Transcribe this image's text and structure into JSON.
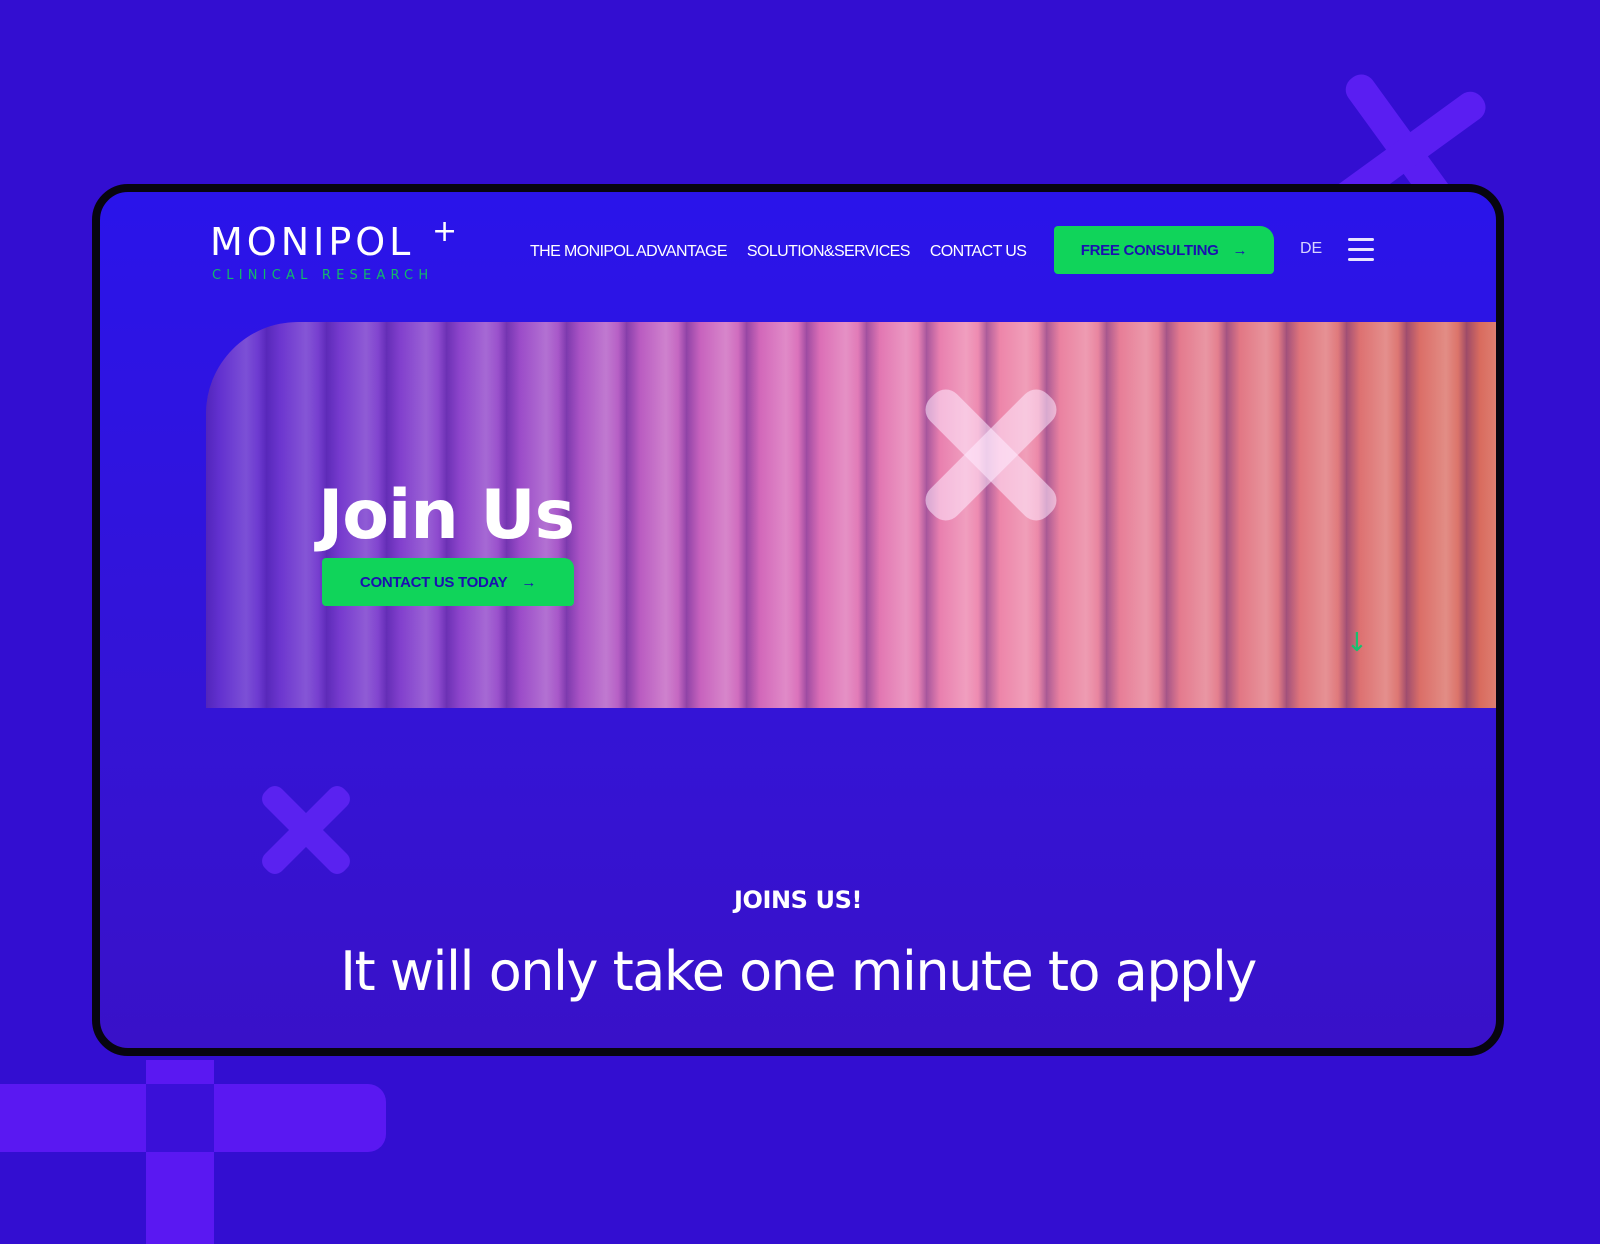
{
  "colors": {
    "background": "#330ed1",
    "accent_green": "#10d45a",
    "logo_sub_green": "#12b96a",
    "frame_border": "#070510",
    "button_text": "#1a10b0"
  },
  "header": {
    "logo": {
      "word": "MONIPOL",
      "plus": "+",
      "sub": "CLINICAL RESEARCH"
    },
    "nav": [
      {
        "label": "THE MONIPOL ADVANTAGE"
      },
      {
        "label": "SOLUTION&SERVICES"
      },
      {
        "label": "CONTACT US"
      }
    ],
    "cta": {
      "label": "FREE CONSULTING",
      "icon": "arrow-right-icon",
      "arrow": "→"
    },
    "language": "DE",
    "menu_icon": "hamburger-menu-icon"
  },
  "hero": {
    "title": "Join Us",
    "cta": {
      "label": "CONTACT US TODAY",
      "icon": "arrow-right-icon",
      "arrow": "→"
    },
    "scroll_icon": "arrow-down-icon",
    "scroll_glyph": "↓"
  },
  "section": {
    "kicker": "JOINS US!",
    "headline": "It will only take one minute to apply"
  }
}
